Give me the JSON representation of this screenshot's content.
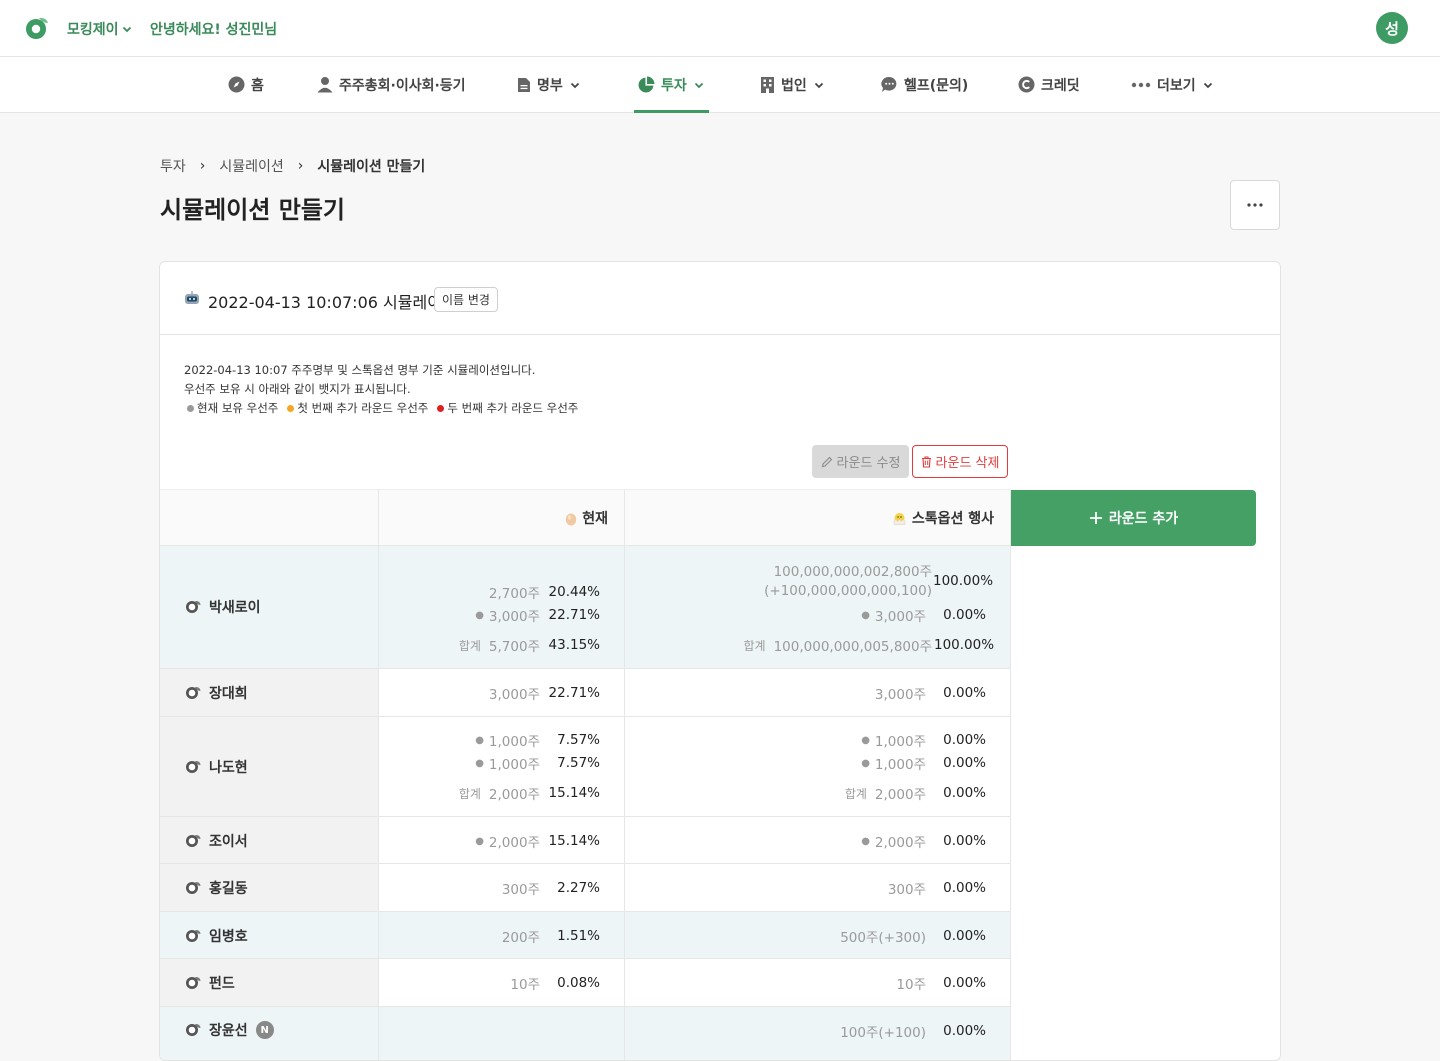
{
  "header": {
    "company": "모킹제이",
    "greeting": "안녕하세요! 성진민님",
    "avatar_initial": "성"
  },
  "nav": {
    "items": [
      {
        "label": "홈",
        "icon": "compass-icon"
      },
      {
        "label": "주주총회·이사회·등기",
        "icon": "person-icon"
      },
      {
        "label": "명부",
        "icon": "document-icon",
        "dropdown": true
      },
      {
        "label": "투자",
        "icon": "pie-chart-icon",
        "dropdown": true,
        "active": true
      },
      {
        "label": "법인",
        "icon": "building-icon",
        "dropdown": true
      },
      {
        "label": "헬프(문의)",
        "icon": "chat-icon"
      },
      {
        "label": "크레딧",
        "icon": "credit-icon"
      },
      {
        "label": "더보기",
        "icon": "more-dots-icon",
        "dropdown": true
      }
    ]
  },
  "breadcrumb": {
    "items": [
      "투자",
      "시뮬레이션",
      "시뮬레이션 만들기"
    ]
  },
  "page": {
    "title": "시뮬레이션 만들기",
    "more_label": "···"
  },
  "simulation": {
    "title": "2022-04-13 10:07:06 시뮬레이션",
    "rename_label": "이름 변경",
    "desc_line1": "2022-04-13 10:07 주주명부 및 스톡옵션 명부 기준 시뮬레이션입니다.",
    "desc_line2": "우선주 보유 시 아래와 같이 뱃지가 표시됩니다.",
    "legend": [
      {
        "label": "현재 보유 우선주",
        "color": "#9a9a9a"
      },
      {
        "label": "첫 번째 추가 라운드 우선주",
        "color": "#f5a623"
      },
      {
        "label": "두 번째 추가 라운드 우선주",
        "color": "#e02020"
      }
    ],
    "edit_round_label": "라운드 수정",
    "delete_round_label": "라운드 삭제",
    "add_round_label": "라운드 추가"
  },
  "table": {
    "columns": [
      {
        "label": "현재",
        "icon": "egg-icon"
      },
      {
        "label": "스톡옵션 행사",
        "icon": "chick-icon"
      }
    ],
    "total_label": "합계",
    "rows": [
      {
        "name": "박새로이",
        "current": {
          "lines": [
            {
              "shares": "2,700주",
              "pct": "20.44%"
            },
            {
              "shares": "3,000주",
              "pct": "22.71%",
              "bullet": true
            }
          ],
          "total": {
            "shares": "5,700주",
            "pct": "43.15%"
          }
        },
        "option": {
          "line1a": "100,000,000,002,800주",
          "line1b": "(+100,000,000,000,100)",
          "pct1": "100.00%",
          "lines": [
            {
              "shares": "3,000주",
              "pct": "0.00%",
              "bullet": true
            }
          ],
          "total": {
            "shares": "100,000,000,005,800주",
            "pct": "100.00%"
          }
        }
      },
      {
        "name": "장대희",
        "current": {
          "shares": "3,000주",
          "pct": "22.71%"
        },
        "option": {
          "shares": "3,000주",
          "pct": "0.00%"
        }
      },
      {
        "name": "나도현",
        "current": {
          "lines": [
            {
              "shares": "1,000주",
              "pct": "7.57%",
              "bullet": true
            },
            {
              "shares": "1,000주",
              "pct": "7.57%",
              "bullet": true
            }
          ],
          "total": {
            "shares": "2,000주",
            "pct": "15.14%"
          }
        },
        "option": {
          "lines": [
            {
              "shares": "1,000주",
              "pct": "0.00%",
              "bullet": true
            },
            {
              "shares": "1,000주",
              "pct": "0.00%",
              "bullet": true
            }
          ],
          "total": {
            "shares": "2,000주",
            "pct": "0.00%"
          }
        }
      },
      {
        "name": "조이서",
        "current": {
          "shares": "2,000주",
          "pct": "15.14%",
          "bullet": true
        },
        "option": {
          "shares": "2,000주",
          "pct": "0.00%",
          "bullet": true
        }
      },
      {
        "name": "홍길동",
        "current": {
          "shares": "300주",
          "pct": "2.27%"
        },
        "option": {
          "shares": "300주",
          "pct": "0.00%"
        }
      },
      {
        "name": "임병호",
        "current": {
          "shares": "200주",
          "pct": "1.51%"
        },
        "option": {
          "shares": "500주(+300)",
          "pct": "0.00%"
        }
      },
      {
        "name": "펀드",
        "current": {
          "shares": "10주",
          "pct": "0.08%"
        },
        "option": {
          "shares": "10주",
          "pct": "0.00%"
        }
      },
      {
        "name": "장윤선",
        "badge": "N",
        "option": {
          "shares": "100주(+100)",
          "pct": "0.00%"
        }
      }
    ]
  }
}
